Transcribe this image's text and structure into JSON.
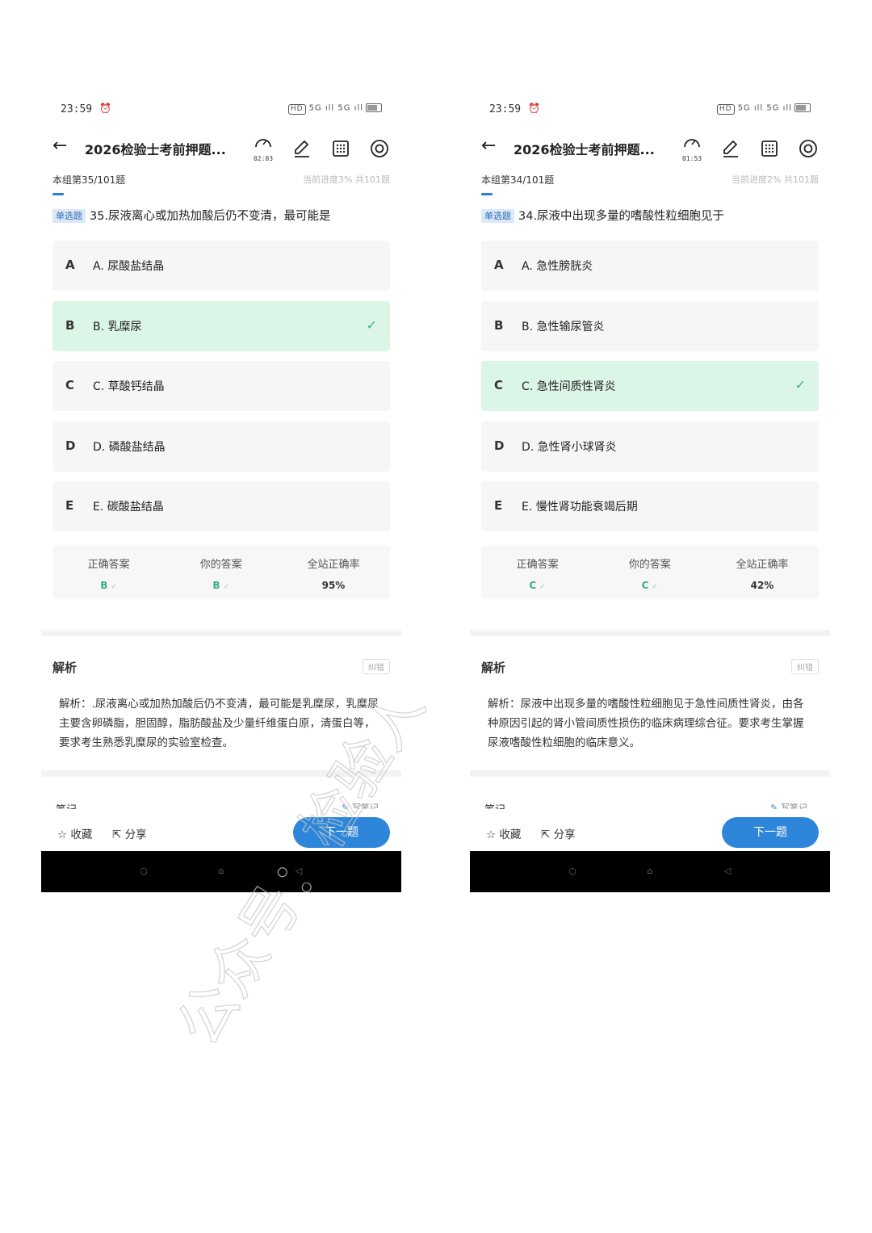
{
  "screens": [
    {
      "status": {
        "time": "23:59",
        "hd": "HD",
        "signal": "5G ıll 5G ıll"
      },
      "header": {
        "title": "2026检验士考前押题...",
        "timer": "02:03"
      },
      "progress": {
        "group_text": "本组第35/101题",
        "current_text": "当前进度3%  共101题",
        "fraction": 0.03
      },
      "question": {
        "tag": "单选题",
        "text": "35.尿液离心或加热加酸后仍不变清，最可能是"
      },
      "options": [
        {
          "letter": "A",
          "text": "A. 尿酸盐结晶",
          "correct": false
        },
        {
          "letter": "B",
          "text": "B. 乳糜尿",
          "correct": true
        },
        {
          "letter": "C",
          "text": "C. 草酸钙结晶",
          "correct": false
        },
        {
          "letter": "D",
          "text": "D. 磷酸盐结晶",
          "correct": false
        },
        {
          "letter": "E",
          "text": "E. 碳酸盐结晶",
          "correct": false
        }
      ],
      "stats": {
        "correct_label": "正确答案",
        "correct_value": "B",
        "yours_label": "你的答案",
        "yours_value": "B",
        "rate_label": "全站正确率",
        "rate_value": "95%"
      },
      "analysis": {
        "title": "解析",
        "report": "纠错",
        "text": "解析：.尿液离心或加热加酸后仍不变清，最可能是乳糜尿，乳糜尿主要含卵磷脂，胆固醇，脂肪酸盐及少量纤维蛋白原，清蛋白等，要求考生熟悉乳糜尿的实验室检查。"
      },
      "notes": {
        "title": "笔记",
        "write": "写笔记"
      },
      "actions": {
        "favorite": "收藏",
        "share": "分享",
        "next": "下一题"
      }
    },
    {
      "status": {
        "time": "23:59",
        "hd": "HD",
        "signal": "5G ıll 5G ıll"
      },
      "header": {
        "title": "2026检验士考前押题...",
        "timer": "01:53"
      },
      "progress": {
        "group_text": "本组第34/101题",
        "current_text": "当前进度2%  共101题",
        "fraction": 0.02
      },
      "question": {
        "tag": "单选题",
        "text": "34.尿液中出现多量的嗜酸性粒细胞见于"
      },
      "options": [
        {
          "letter": "A",
          "text": "A. 急性膀胱炎",
          "correct": false
        },
        {
          "letter": "B",
          "text": "B. 急性输尿管炎",
          "correct": false
        },
        {
          "letter": "C",
          "text": "C. 急性间质性肾炎",
          "correct": true
        },
        {
          "letter": "D",
          "text": "D. 急性肾小球肾炎",
          "correct": false
        },
        {
          "letter": "E",
          "text": "E. 慢性肾功能衰竭后期",
          "correct": false
        }
      ],
      "stats": {
        "correct_label": "正确答案",
        "correct_value": "C",
        "yours_label": "你的答案",
        "yours_value": "C",
        "rate_label": "全站正确率",
        "rate_value": "42%"
      },
      "analysis": {
        "title": "解析",
        "report": "纠错",
        "text": "解析：尿液中出现多量的嗜酸性粒细胞见于急性间质性肾炎，由各种原因引起的肾小管间质性损伤的临床病理综合征。要求考生掌握尿液嗜酸性粒细胞的临床意义。"
      },
      "notes": {
        "title": "笔记",
        "write": "写笔记"
      },
      "actions": {
        "favorite": "收藏",
        "share": "分享",
        "next": "下一题"
      }
    }
  ],
  "watermark": {
    "text": "公众号：检验人"
  },
  "colors": {
    "accent": "#2d86d9",
    "correct_bg": "#dbf5e7",
    "correct_text": "#39b07a",
    "tag_bg": "#dbe8f8"
  }
}
